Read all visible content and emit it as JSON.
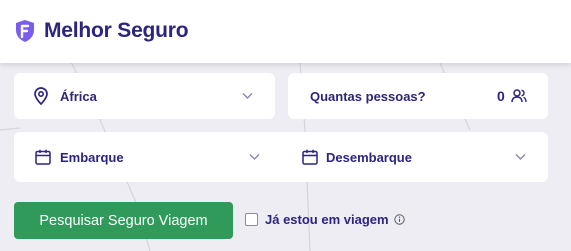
{
  "brand": {
    "name": "Melhor Seguro",
    "color": "#2c2580",
    "accent": "#7b5cf0"
  },
  "search_form": {
    "destination": {
      "value": "África",
      "icon": "map-pin-icon"
    },
    "passengers": {
      "label": "Quantas pessoas?",
      "count": "0",
      "icon": "users-icon"
    },
    "departure": {
      "label": "Embarque",
      "icon": "calendar-icon"
    },
    "return": {
      "label": "Desembarque",
      "icon": "calendar-icon"
    },
    "submit_label": "Pesquisar Seguro Viagem",
    "already_traveling_label": "Já estou em viagem",
    "already_traveling_checked": false
  },
  "colors": {
    "primary_button": "#2f9a5a",
    "background": "#ededf3",
    "text": "#2c2580"
  }
}
